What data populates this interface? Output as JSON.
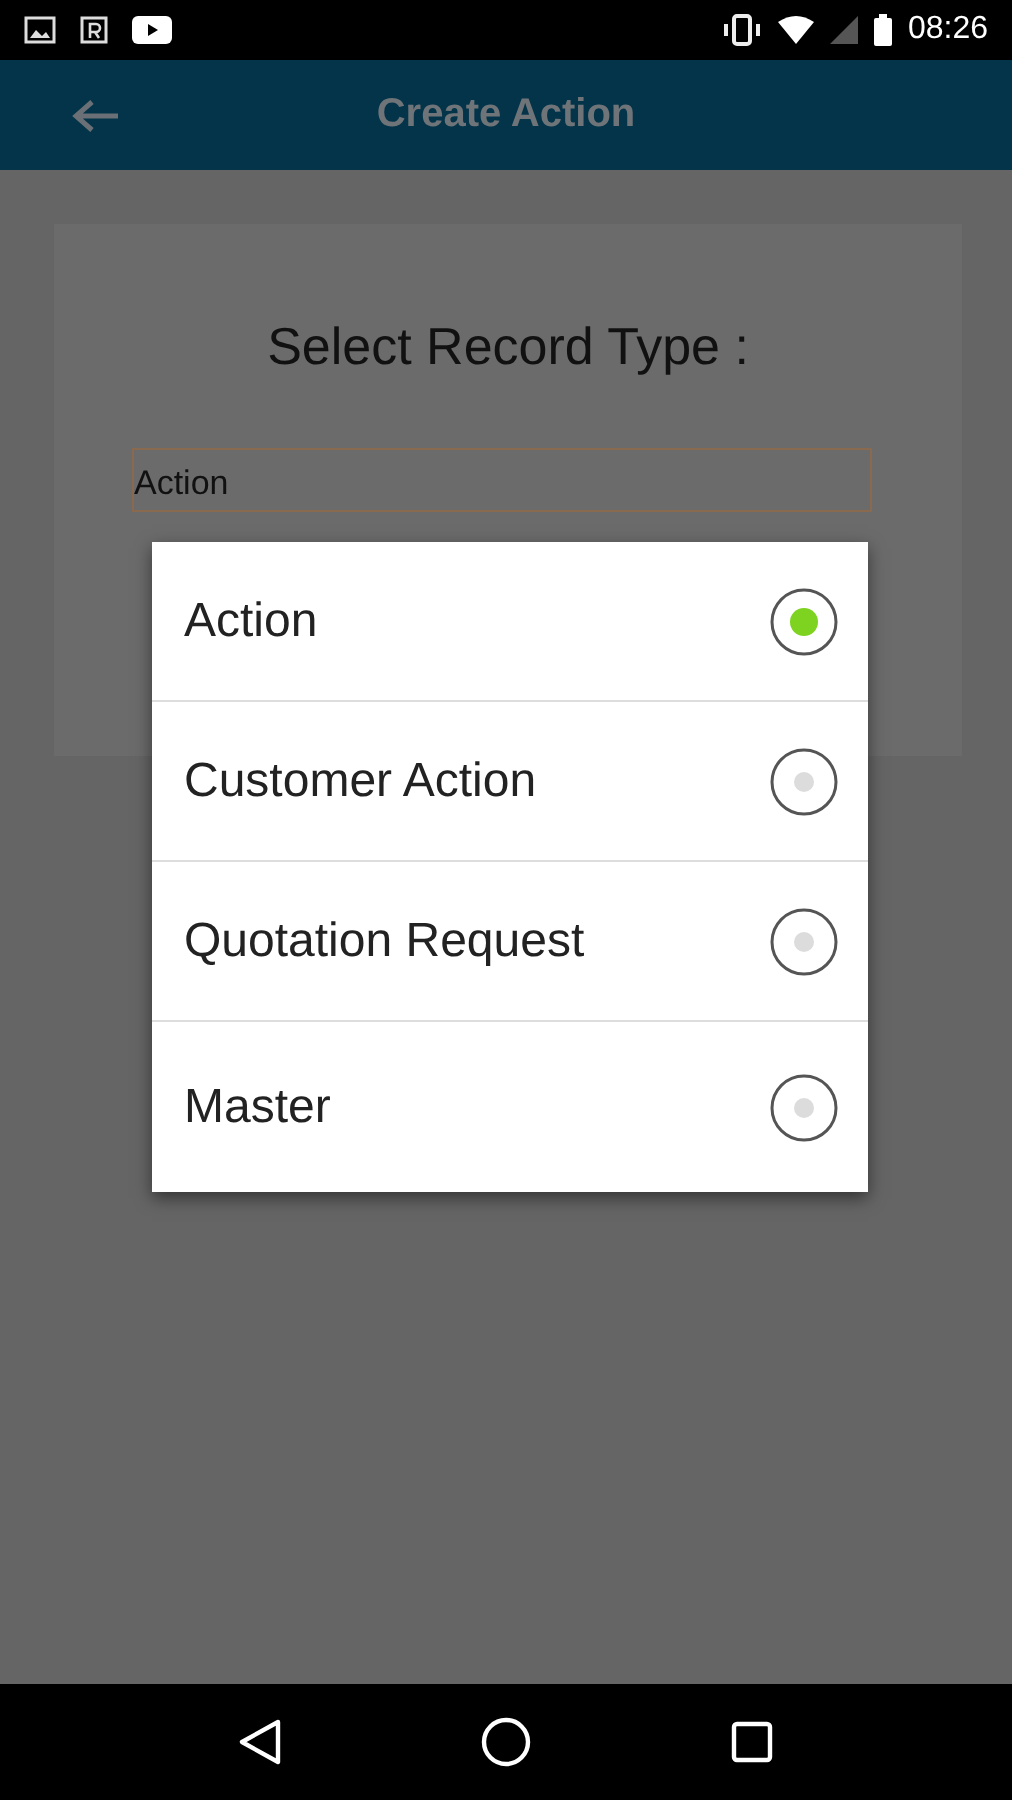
{
  "status_bar": {
    "time": "08:26"
  },
  "app_bar": {
    "title": "Create Action"
  },
  "form": {
    "title": "Select Record Type :",
    "field": {
      "value": "Action"
    }
  },
  "dialog": {
    "options": [
      {
        "label": "Action",
        "selected": true
      },
      {
        "label": "Customer Action",
        "selected": false
      },
      {
        "label": "Quotation Request",
        "selected": false
      },
      {
        "label": "Master",
        "selected": false
      }
    ]
  }
}
